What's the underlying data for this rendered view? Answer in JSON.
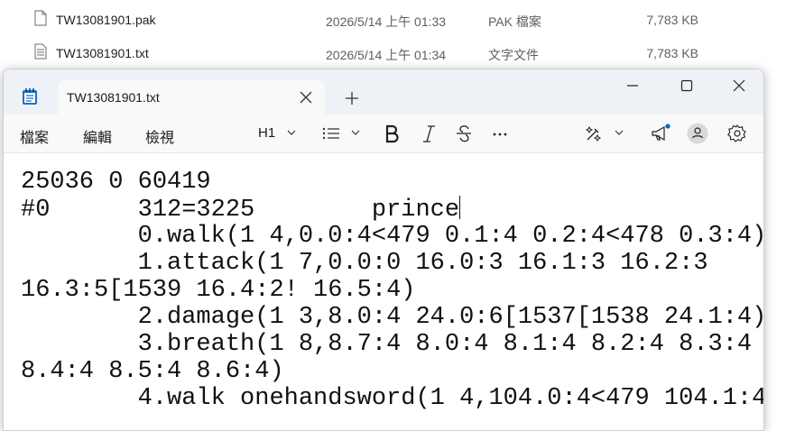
{
  "explorer": {
    "files": [
      {
        "name": "TW13081901.pak",
        "date": "2026/5/14 上午 01:33",
        "type": "PAK 檔案",
        "size": "7,783 KB",
        "icon": "blank-file-icon"
      },
      {
        "name": "TW13081901.txt",
        "date": "2026/5/14 上午 01:34",
        "type": "文字文件",
        "size": "7,783 KB",
        "icon": "text-file-icon"
      }
    ]
  },
  "notepad": {
    "tab_title": "TW13081901.txt",
    "menu": {
      "file": "檔案",
      "edit": "編輯",
      "view": "檢視"
    },
    "toolbar": {
      "heading": "H1"
    },
    "icons": [
      "notepad-app-icon",
      "tab-close-icon",
      "new-tab-icon",
      "minimize-icon",
      "maximize-icon",
      "close-icon",
      "list-icon",
      "bold-icon",
      "italic-icon",
      "strikethrough-icon",
      "more-icon",
      "copilot-icon",
      "announcement-icon",
      "account-icon",
      "settings-icon"
    ]
  },
  "editor": {
    "lines": [
      "25036 0 60419",
      "#0      312=3225        prince",
      "        0.walk(1 4,0.0:4<479 0.1:4 0.2:4<478 0.3:4)",
      "        1.attack(1 7,0.0:0 16.0:3 16.1:3 16.2:3",
      "16.3:5[1539 16.4:2! 16.5:4)",
      "        2.damage(1 3,8.0:4 24.0:6[1537[1538 24.1:4)",
      "        3.breath(1 8,8.7:4 8.0:4 8.1:4 8.2:4 8.3:4",
      "8.4:4 8.5:4 8.6:4)",
      "        4.walk onehandsword(1 4,104.0:4<479 104.1:4"
    ]
  },
  "colors": {
    "titlebar": "#eef1f6",
    "accent": "#0067c0"
  }
}
